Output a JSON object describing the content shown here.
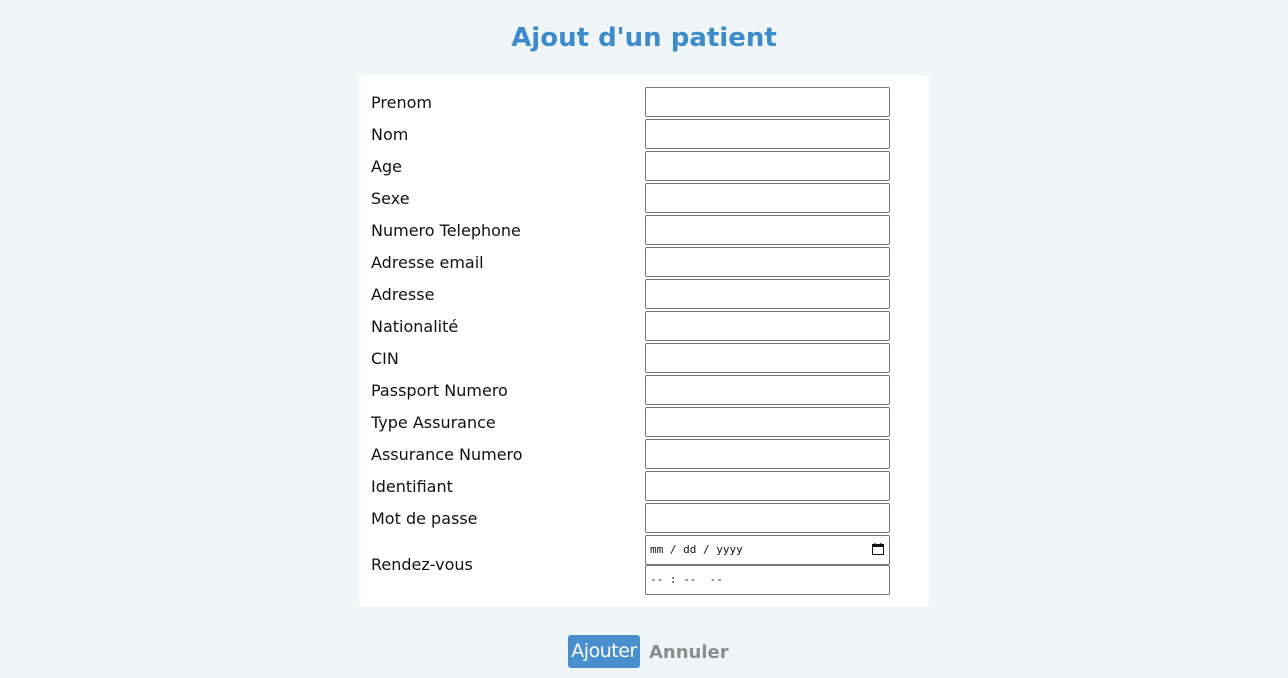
{
  "title": "Ajout d'un patient",
  "form": {
    "fields": [
      {
        "label": "Prenom",
        "value": ""
      },
      {
        "label": "Nom",
        "value": ""
      },
      {
        "label": "Age",
        "value": ""
      },
      {
        "label": "Sexe",
        "value": ""
      },
      {
        "label": "Numero Telephone",
        "value": ""
      },
      {
        "label": "Adresse email",
        "value": ""
      },
      {
        "label": "Adresse",
        "value": ""
      },
      {
        "label": "Nationalité",
        "value": ""
      },
      {
        "label": "CIN",
        "value": ""
      },
      {
        "label": "Passport Numero",
        "value": ""
      },
      {
        "label": "Type Assurance",
        "value": ""
      },
      {
        "label": "Assurance Numero",
        "value": ""
      },
      {
        "label": "Identifiant",
        "value": ""
      },
      {
        "label": "Mot de passe",
        "value": ""
      }
    ],
    "rendezvous": {
      "label": "Rendez-vous",
      "date_placeholder": "mm / dd / yyyy",
      "time_placeholder": "-- : --  --"
    }
  },
  "actions": {
    "add_label": "Ajouter",
    "cancel_label": "Annuler"
  },
  "colors": {
    "title": "#3d8bcd",
    "background": "#f0f5f8",
    "button": "#4a8fcd",
    "cancel": "#8c8c8c"
  }
}
